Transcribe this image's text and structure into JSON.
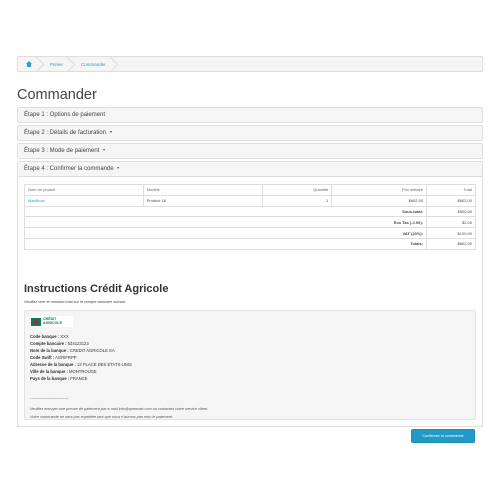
{
  "breadcrumb": {
    "items": [
      {
        "label": "Panier"
      },
      {
        "label": "Commander"
      }
    ]
  },
  "page_title": "Commander",
  "steps": [
    {
      "label": "Étape 1 : Options de paiement"
    },
    {
      "label": "Étape 2 : Détails de facturation"
    },
    {
      "label": "Étape 3 : Mode de paiement"
    },
    {
      "label": "Étape 4 : Confirmer la commande"
    }
  ],
  "order_table": {
    "headers": [
      "Nom du produit",
      "Modèle",
      "Quantité",
      "Prix unitaire",
      "Total"
    ],
    "rows": [
      {
        "name": "MacBook",
        "model": "Product 16",
        "qty": "1",
        "unit": "$602.00",
        "total": "$602.00"
      }
    ],
    "totals": [
      {
        "label": "Sous-total:",
        "value": "$500.00"
      },
      {
        "label": "Eco Tax (-2.00):",
        "value": "$2.00"
      },
      {
        "label": "VAT (20%):",
        "value": "$100.00"
      },
      {
        "label": "Totals:",
        "value": "$602.00"
      }
    ]
  },
  "instructions": {
    "title": "Instructions Crédit Agricole",
    "subtitle": "Veuillez virer le montant total sur le compte bancaire suivant.",
    "logo_line1": "CRÉDIT",
    "logo_line2": "AGRICOLE",
    "fields": [
      {
        "label": "Code banque :",
        "value": "XXX"
      },
      {
        "label": "Compte bancaire :",
        "value": "534123123"
      },
      {
        "label": "Nom de la banque :",
        "value": "CREDIT AGRICOLE SA"
      },
      {
        "label": "Code Swift :",
        "value": "AGRIFRPP"
      },
      {
        "label": "Adresse de la banque :",
        "value": "12 PLACE DES ETATS-UNIS"
      },
      {
        "label": "Ville de la banque :",
        "value": "MONTROUGE"
      },
      {
        "label": "Pays de la banque :",
        "value": "FRANCE"
      }
    ],
    "separator": "-----------------------------",
    "note1": "Veuillez envoyer une preuve de paiement par e-mail info@opencart.com ou contactez notre service client.",
    "note2": "Votre commande ne sera pas expédiée tant que nous n'aurons pas reçu le paiement."
  },
  "confirm_button": "Confirmez la commande"
}
